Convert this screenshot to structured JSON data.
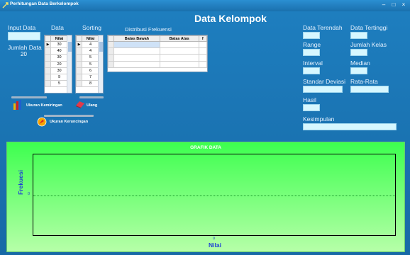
{
  "window": {
    "title": "Perhitungan Data Berkelompok",
    "controls": [
      "–",
      "□",
      "×"
    ]
  },
  "heading": "Data Kelompok",
  "labels": {
    "input_data": "Input Data",
    "data": "Data",
    "sorting": "Sorting",
    "jumlah_data": "Jumlah Data",
    "distribusi": "Distribusi Frekuensi"
  },
  "jumlah_data_value": "20",
  "data_grid": {
    "header": "Nilai",
    "rows": [
      "30",
      "40",
      "30",
      "20",
      "30",
      "9",
      "5"
    ],
    "current_row": 0
  },
  "sorting_grid": {
    "header": "Nilai",
    "rows": [
      "4",
      "4",
      "5",
      "5",
      "6",
      "7",
      "8"
    ],
    "current_row": 0
  },
  "freq_grid": {
    "headers": [
      "Batas Bawah",
      "Batas Atas",
      "f"
    ]
  },
  "buttons": {
    "kemiringan": "Ukuran Kemiringan",
    "ulang": "Ulang",
    "keruncingan": "Ukuran Keruncingan"
  },
  "stats": {
    "data_terendah": "Data Terendah",
    "data_tertinggi": "Data Tertinggi",
    "range": "Range",
    "jumlah_kelas": "Jumlah Kelas",
    "interval": "Interval",
    "median": "Median",
    "standar_deviasi": "Standar Deviasi",
    "rata_rata": "Rata-Rata",
    "hasil": "Hasil",
    "kesimpulan": "Kesimpulan"
  },
  "chart_data": {
    "type": "line",
    "title": "GRAFIK DATA",
    "xlabel": "Nilai",
    "ylabel": "Frekuesi",
    "x_ticks": [
      "0"
    ],
    "y_ticks": [
      "0"
    ],
    "series": []
  },
  "colors": {
    "window_bg": "#1873b0",
    "chart_bg_top": "#3dff4f",
    "chart_bg_bottom": "#b6ffa8",
    "field_bg": "#d6f7ff",
    "axis_label": "#1f3fd6"
  }
}
